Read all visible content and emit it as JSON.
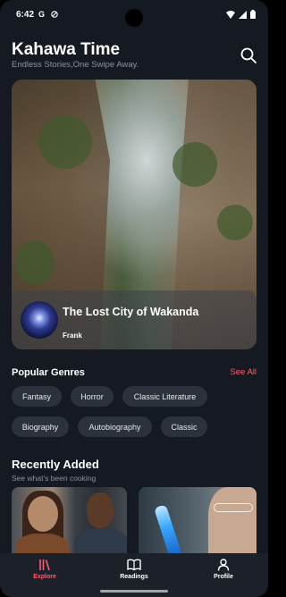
{
  "status_bar": {
    "time": "6:42",
    "left_icons": [
      "google-icon",
      "vpn-icon"
    ],
    "right_icons": [
      "wifi-icon",
      "signal-icon",
      "battery-icon"
    ]
  },
  "header": {
    "title": "Kahawa Time",
    "tagline": "Endless Stories,One Swipe Away.",
    "search_icon": "search-icon"
  },
  "featured": {
    "title": "The Lost City of Wakanda",
    "author": "Frank"
  },
  "genres": {
    "title": "Popular Genres",
    "see_all": "See All",
    "items": [
      "Fantasy",
      "Horror",
      "Classic Literature",
      "Biography",
      "Autobiography",
      "Classic"
    ]
  },
  "recent": {
    "title": "Recently Added",
    "subtitle": "See what's been cooking"
  },
  "nav": {
    "items": [
      {
        "label": "Explore",
        "icon": "library-icon",
        "active": true
      },
      {
        "label": "Readings",
        "icon": "book-open-icon",
        "active": false
      },
      {
        "label": "Profile",
        "icon": "user-icon",
        "active": false
      }
    ]
  },
  "colors": {
    "background": "#151a22",
    "accent": "#ff5e6e",
    "chip": "#2c323c",
    "nav": "#1b2029"
  }
}
